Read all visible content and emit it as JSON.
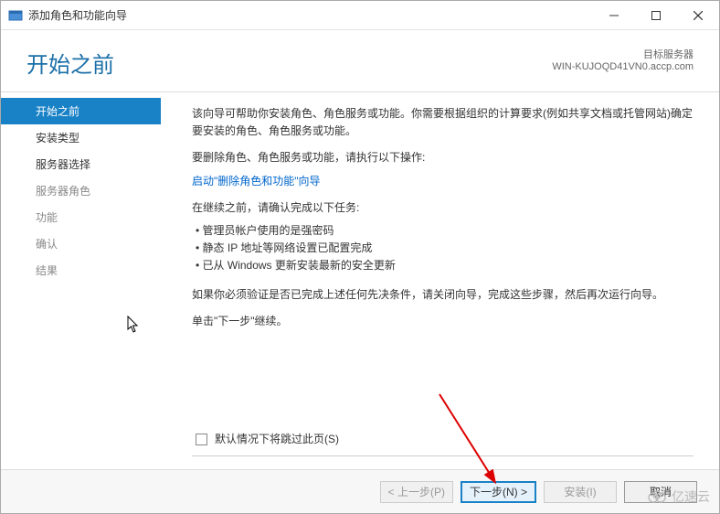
{
  "titlebar": {
    "title": "添加角色和功能向导"
  },
  "header": {
    "title": "开始之前",
    "server_label": "目标服务器",
    "server_name": "WIN-KUJOQD41VN0.accp.com"
  },
  "sidebar": {
    "items": [
      {
        "label": "开始之前",
        "active": true
      },
      {
        "label": "安装类型",
        "enabled": true
      },
      {
        "label": "服务器选择",
        "enabled": true
      },
      {
        "label": "服务器角色"
      },
      {
        "label": "功能"
      },
      {
        "label": "确认"
      },
      {
        "label": "结果"
      }
    ]
  },
  "content": {
    "intro": "该向导可帮助你安装角色、角色服务或功能。你需要根据组织的计算要求(例如共享文档或托管网站)确定要安装的角色、角色服务或功能。",
    "remove_label": "要删除角色、角色服务或功能，请执行以下操作:",
    "remove_link": "启动\"删除角色和功能\"向导",
    "confirm_label": "在继续之前，请确认完成以下任务:",
    "tasks": [
      "管理员帐户使用的是强密码",
      "静态 IP 地址等网络设置已配置完成",
      "已从 Windows 更新安装最新的安全更新"
    ],
    "verify": "如果你必须验证是否已完成上述任何先决条件，请关闭向导，完成这些步骤，然后再次运行向导。",
    "continue": "单击\"下一步\"继续。",
    "skip_label": "默认情况下将跳过此页(S)"
  },
  "footer": {
    "prev": "< 上一步(P)",
    "next": "下一步(N) >",
    "install": "安装(I)",
    "cancel": "取消"
  },
  "watermark": "亿速云"
}
